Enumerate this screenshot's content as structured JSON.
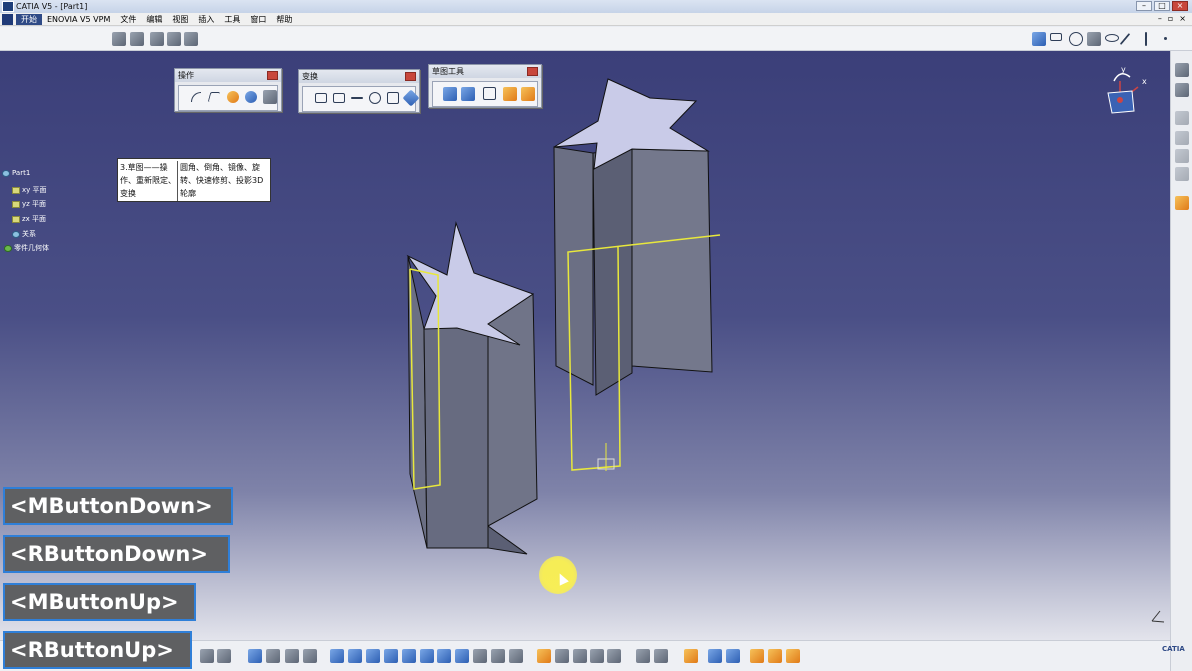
{
  "window": {
    "title": "CATIA V5 - [Part1]"
  },
  "menu": {
    "items": [
      "开始",
      "ENOVIA V5 VPM",
      "文件",
      "编辑",
      "视图",
      "插入",
      "工具",
      "窗口",
      "帮助"
    ],
    "active_index": 0
  },
  "floating_toolbars": {
    "operation": {
      "title": "操作"
    },
    "transform": {
      "title": "变换"
    },
    "sketch_tools": {
      "title": "草图工具"
    }
  },
  "tree": {
    "root": "Part1",
    "items": [
      "xy 平面",
      "yz 平面",
      "zx 平面",
      "关系",
      "零件几何体"
    ]
  },
  "callout": {
    "left": "3.草图——操作、重新限定、变换",
    "right": "圆角、倒角、镜像、旋转、快速修剪、投影3D轮廓"
  },
  "button_events": [
    "<MButtonDown>",
    "<RButtonDown>",
    "<MButtonUp>",
    "<RButtonUp>"
  ],
  "compass": {
    "x_label": "x",
    "y_label": "y"
  },
  "brand": "CATIA",
  "colors": {
    "background_top": "#3b3f79",
    "background_bottom": "#e3e4ec",
    "solid_face": "#6e7286",
    "star_top": "#c9cbe8",
    "sketch_line": "#e8e83c",
    "label_border": "#2f7fd8",
    "label_bg": "#5f6062"
  }
}
